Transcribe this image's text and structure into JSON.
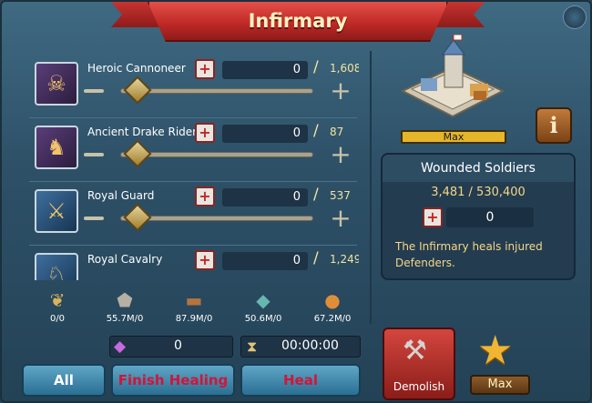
{
  "title": "Infirmary",
  "troops": [
    {
      "name": "Heroic Cannoneer",
      "quantity": "0",
      "max": "1,608",
      "portrait": "cannoneer-portrait"
    },
    {
      "name": "Ancient Drake Rider",
      "quantity": "0",
      "max": "87",
      "portrait": "drake-rider-portrait"
    },
    {
      "name": "Royal Guard",
      "quantity": "0",
      "max": "537",
      "portrait": "royal-guard-portrait"
    },
    {
      "name": "Royal Cavalry",
      "quantity": "0",
      "max": "1,249",
      "portrait": "royal-cavalry-portrait"
    }
  ],
  "resources": [
    {
      "icon": "food-icon",
      "value": "0/0"
    },
    {
      "icon": "stone-icon",
      "value": "55.7M/0"
    },
    {
      "icon": "wood-icon",
      "value": "87.9M/0"
    },
    {
      "icon": "ore-icon",
      "value": "50.6M/0"
    },
    {
      "icon": "gold-icon",
      "value": "67.2M/0"
    }
  ],
  "gem_cost": "0",
  "heal_time": "00:00:00",
  "buttons": {
    "all": "All",
    "finish_healing": "Finish Healing",
    "heal": "Heal",
    "demolish": "Demolish",
    "max": "Max"
  },
  "building": {
    "level_label": "Max",
    "info_label": "i"
  },
  "wounded": {
    "heading": "Wounded Soldiers",
    "count": "3,481 / 530,400",
    "value": "0",
    "description": "The Infirmary heals injured Defenders."
  }
}
